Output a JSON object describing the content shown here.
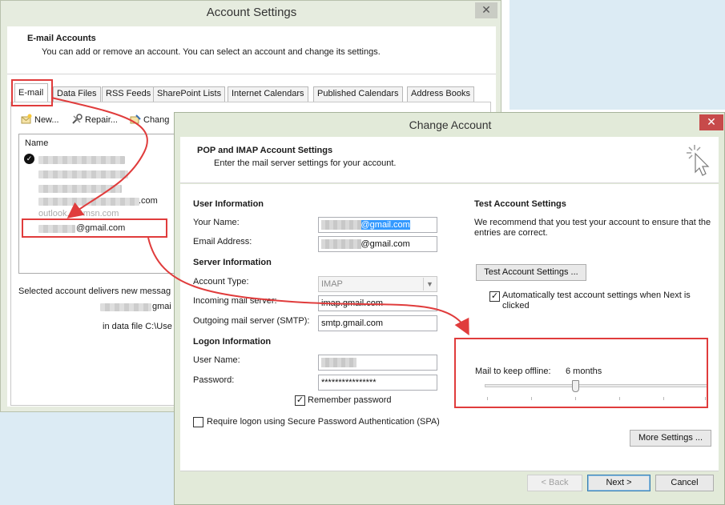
{
  "account_settings": {
    "title": "Account Settings",
    "header_title": "E-mail Accounts",
    "header_subtitle": "You can add or remove an account. You can select an account and change its settings.",
    "tabs": [
      {
        "label": "E-mail",
        "active": true
      },
      {
        "label": "Data Files"
      },
      {
        "label": "RSS Feeds"
      },
      {
        "label": "SharePoint Lists"
      },
      {
        "label": "Internet Calendars"
      },
      {
        "label": "Published Calendars"
      },
      {
        "label": "Address Books"
      }
    ],
    "toolbar": {
      "new_label": "New...",
      "repair_label": "Repair...",
      "change_label": "Chang"
    },
    "list_header": "Name",
    "list_partials": {
      "row4": ".com",
      "row5": "outlook...@msn.com",
      "row6": "@gmail.com"
    },
    "delivers_text": "Selected account delivers new messag",
    "delivers_account": "gmai",
    "data_file_text": "in data file C:\\Use"
  },
  "change_account": {
    "title": "Change Account",
    "header_title": "POP and IMAP Account Settings",
    "header_subtitle": "Enter the mail server settings for your account.",
    "user_info": {
      "heading": "User Information",
      "your_name_label": "Your Name:",
      "your_name_value": "@gmail.com",
      "email_label": "Email Address:",
      "email_value": "@gmail.com"
    },
    "server_info": {
      "heading": "Server Information",
      "account_type_label": "Account Type:",
      "account_type_value": "IMAP",
      "incoming_label": "Incoming mail server:",
      "incoming_value": "imap.gmail.com",
      "outgoing_label": "Outgoing mail server (SMTP):",
      "outgoing_value": "smtp.gmail.com"
    },
    "logon_info": {
      "heading": "Logon Information",
      "username_label": "User Name:",
      "password_label": "Password:",
      "password_value": "****************",
      "remember_label": "Remember password",
      "remember_checked": true,
      "spa_label": "Require logon using Secure Password Authentication (SPA)",
      "spa_checked": false
    },
    "test": {
      "heading": "Test Account Settings",
      "description": "We recommend that you test your account to ensure that the entries are correct.",
      "button_label": "Test Account Settings ...",
      "auto_test_label": "Automatically test account settings when Next is clicked",
      "auto_test_checked": true
    },
    "offline": {
      "label": "Mail to keep offline:",
      "value": "6 months",
      "slider_position": 0.4
    },
    "more_settings_label": "More Settings ...",
    "back_label": "< Back",
    "next_label": "Next >",
    "cancel_label": "Cancel"
  },
  "colors": {
    "annotation": "#e03c3c",
    "selection": "#3399ff",
    "window_frame": "#e2ead9"
  }
}
